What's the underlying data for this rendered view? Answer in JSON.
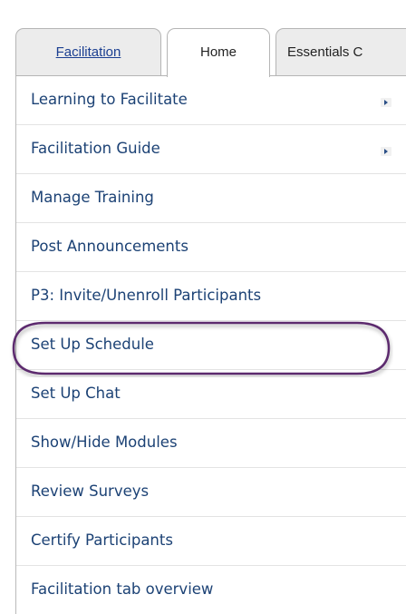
{
  "tabs": [
    {
      "label": "Facilitation"
    },
    {
      "label": "Home"
    },
    {
      "label": "Essentials C"
    }
  ],
  "menu": {
    "items": [
      {
        "label": "Learning to Facilitate"
      },
      {
        "label": "Facilitation Guide"
      },
      {
        "label": "Manage Training"
      },
      {
        "label": "Post Announcements"
      },
      {
        "label": "P3: Invite/Unenroll Participants"
      },
      {
        "label": "Set Up Schedule"
      },
      {
        "label": "Set Up Chat"
      },
      {
        "label": "Show/Hide Modules"
      },
      {
        "label": "Review Surveys"
      },
      {
        "label": "Certify Participants"
      },
      {
        "label": "Facilitation tab overview"
      }
    ]
  },
  "highlight": {
    "color": "#5c2a6e"
  },
  "colors": {
    "link": "#1c4275",
    "tab_link": "#1b3f91"
  }
}
